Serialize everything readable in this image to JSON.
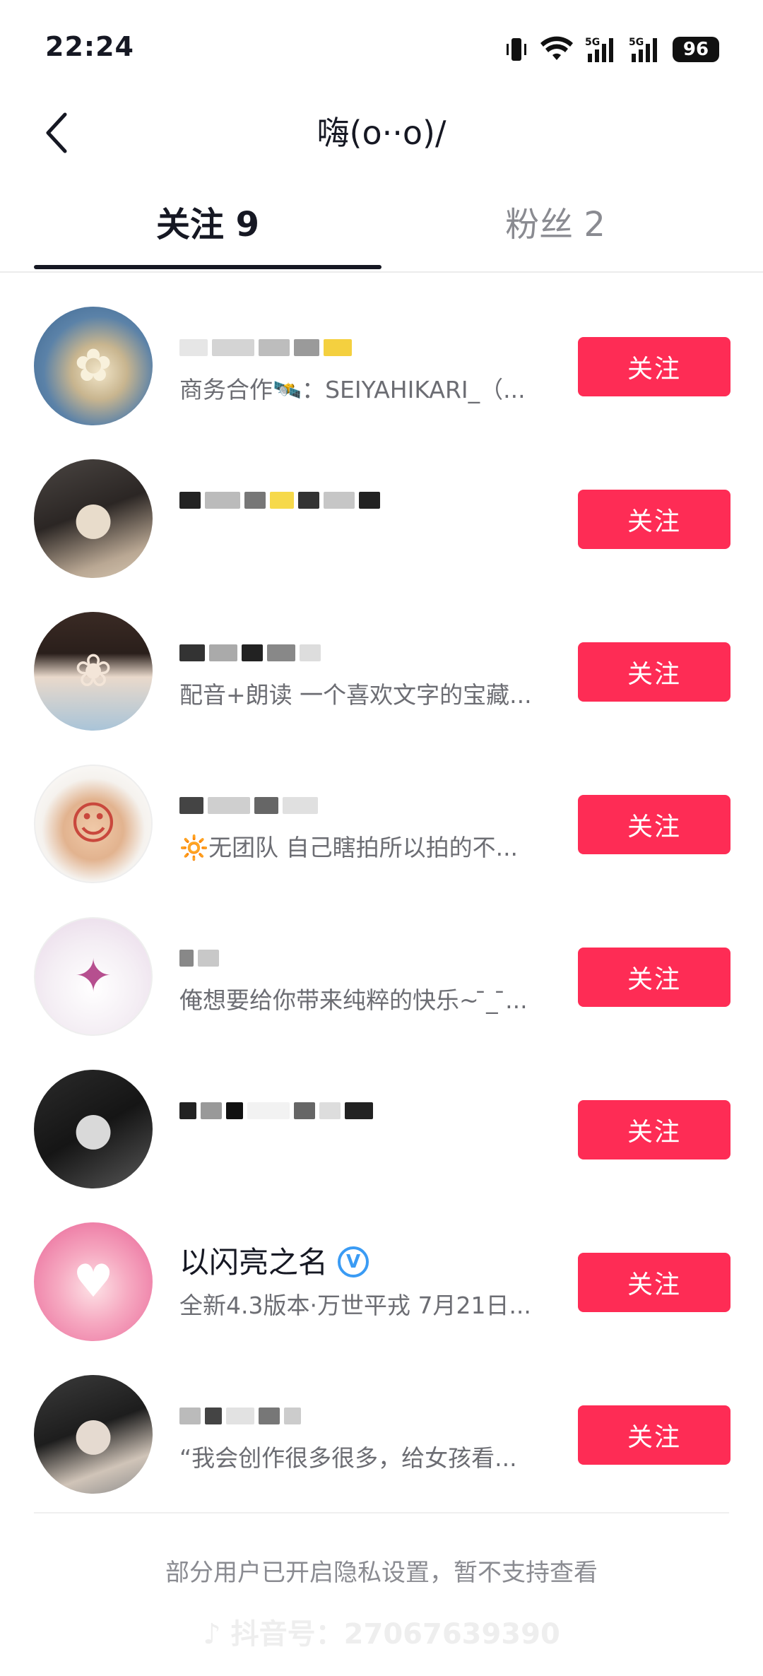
{
  "status_bar": {
    "time": "22:24",
    "battery": "96",
    "network_1": "5G",
    "network_2": "5G"
  },
  "header": {
    "title": "嗨(o··o)/"
  },
  "tabs": [
    {
      "label": "关注 9",
      "active": true
    },
    {
      "label": "粉丝 2",
      "active": false
    }
  ],
  "users": [
    {
      "name": "",
      "bio": "商务合作🛰️：SEIYAHIKARI_（...",
      "button": "关注"
    },
    {
      "name": "",
      "bio": "",
      "button": "关注"
    },
    {
      "name": "",
      "bio": "配音+朗读 一个喜欢文字的宝藏...",
      "button": "关注"
    },
    {
      "name": "",
      "bio": "🔆无团队 自己瞎拍所以拍的不...",
      "button": "关注"
    },
    {
      "name": "",
      "bio": "俺想要给你带来纯粹的快乐~ ̄_ ̄...",
      "button": "关注"
    },
    {
      "name": "",
      "bio": "",
      "button": "关注"
    },
    {
      "name": "以闪亮之名",
      "bio": "全新4.3版本·万世平戎 7月21日...",
      "button": "关注",
      "verified": true
    },
    {
      "name": "",
      "bio": "“我会创作很多很多，给女孩看...",
      "button": "关注"
    }
  ],
  "footer": {
    "privacy_note": "部分用户已开启隐私设置，暂不支持查看",
    "watermark": "抖音号：27067639390"
  },
  "colors": {
    "accent": "#fe2c55",
    "verified": "#3a9bf4"
  }
}
